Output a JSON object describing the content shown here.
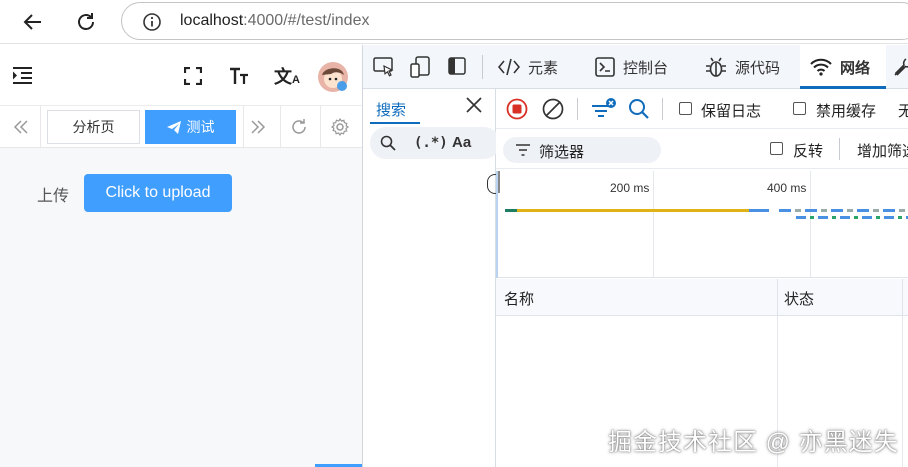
{
  "browser": {
    "url_host": "localhost",
    "url_rest": ":4000/#/test/index"
  },
  "app": {
    "tabs": [
      {
        "label": "分析页",
        "active": false
      },
      {
        "label": "测试",
        "active": true
      }
    ],
    "upload_label": "上传",
    "upload_button": "Click to upload"
  },
  "devtools": {
    "tabs": [
      {
        "label": "元素",
        "icon": "code-icon"
      },
      {
        "label": "控制台",
        "icon": "console-icon"
      },
      {
        "label": "源代码",
        "icon": "bug-icon"
      },
      {
        "label": "网络",
        "icon": "wifi-icon",
        "active": true
      }
    ],
    "search": {
      "tab_label": "搜索",
      "regex_label": "(.*)",
      "case_label": "Aa"
    },
    "network": {
      "preserve_log": "保留日志",
      "disable_cache": "禁用缓存",
      "throttle_partial": "无",
      "filter_placeholder": "筛选器",
      "invert": "反转",
      "more_filters": "增加筛选",
      "ticks": [
        "200 ms",
        "400 ms"
      ],
      "columns": [
        "名称",
        "状态"
      ]
    }
  },
  "watermark": "掘金技术社区 @ 亦黑迷失",
  "colors": {
    "primary": "#409eff",
    "devtools_accent": "#0f6cbd",
    "record_red": "#d93025"
  }
}
